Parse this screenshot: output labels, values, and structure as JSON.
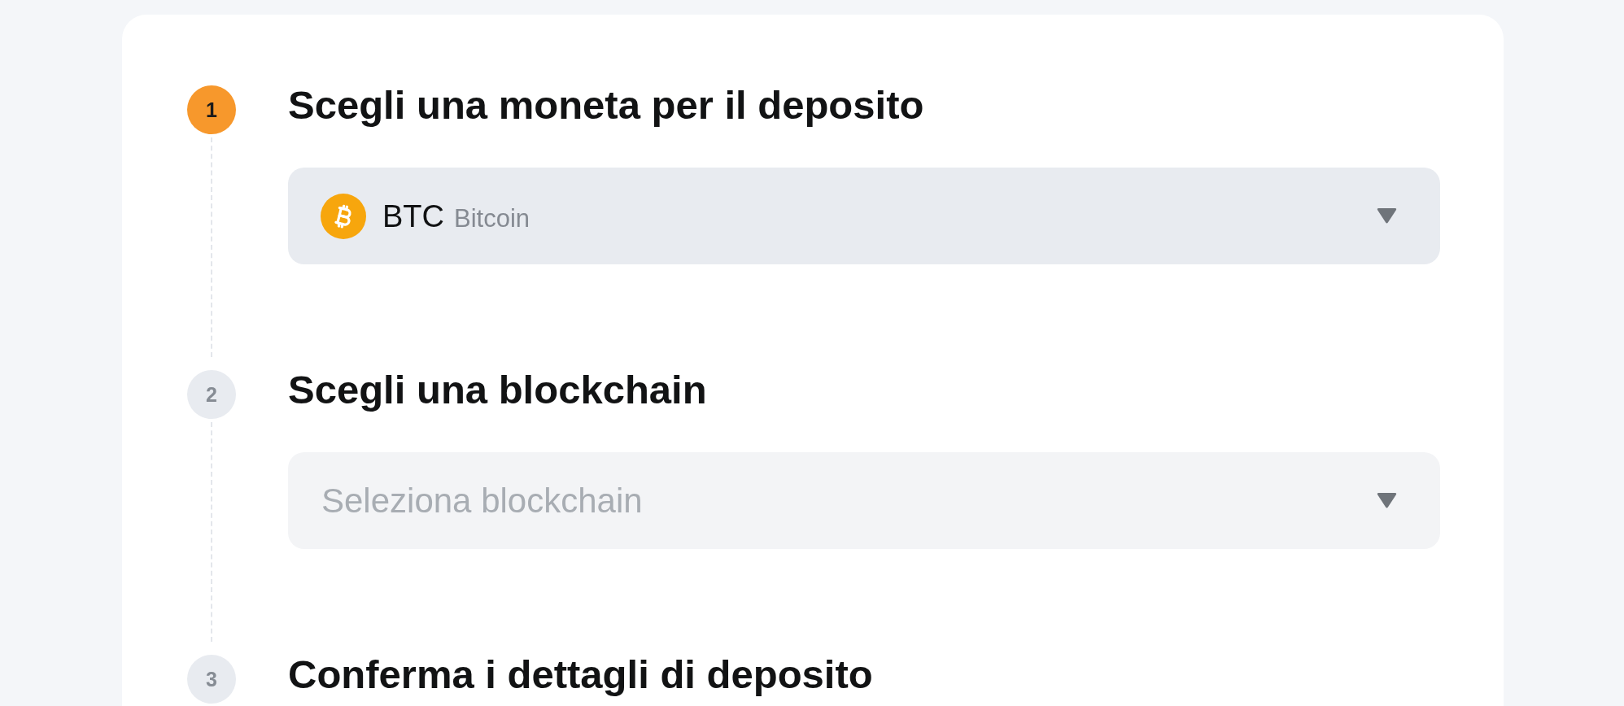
{
  "steps": [
    {
      "number": "1",
      "title": "Scegli una moneta per il deposito",
      "active": true,
      "select": {
        "kind": "coin",
        "symbol": "BTC",
        "name": "Bitcoin"
      }
    },
    {
      "number": "2",
      "title": "Scegli una blockchain",
      "active": false,
      "select": {
        "kind": "empty",
        "placeholder": "Seleziona blockchain"
      }
    },
    {
      "number": "3",
      "title": "Conferma i dettagli di deposito",
      "active": false
    }
  ]
}
